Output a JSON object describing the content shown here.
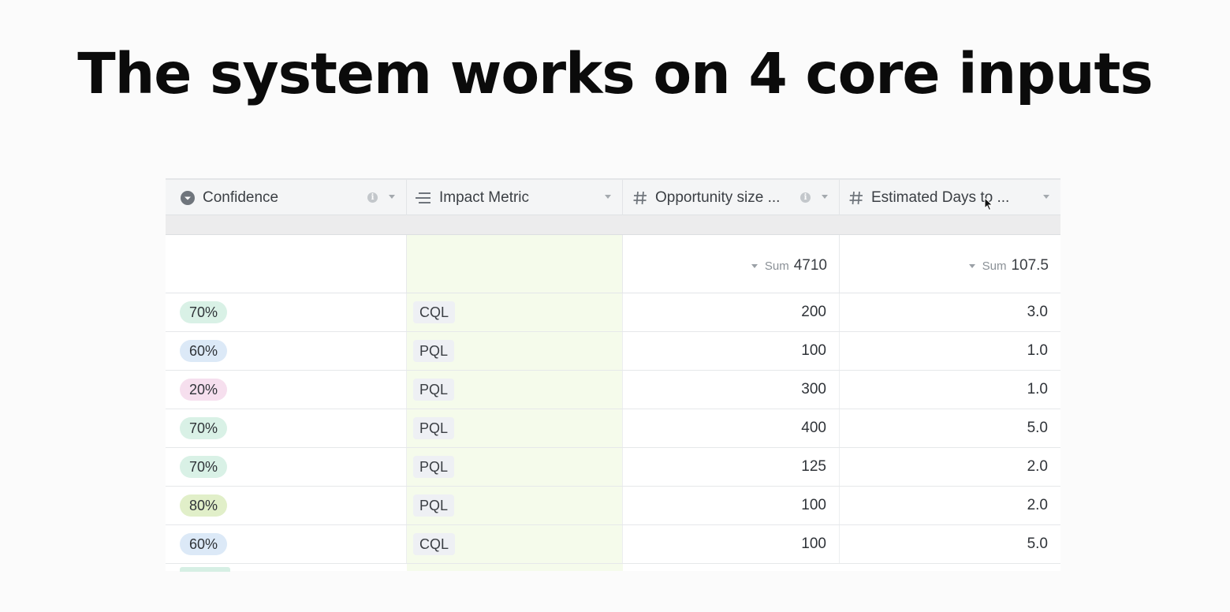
{
  "slide": {
    "title": "The system works on 4 core inputs"
  },
  "table": {
    "columns": [
      {
        "label": "Confidence",
        "icon": "single-select-icon",
        "has_info": true
      },
      {
        "label": "Impact Metric",
        "icon": "long-text-icon",
        "has_info": false
      },
      {
        "label": "Opportunity size ...",
        "icon": "number-hash-icon",
        "has_info": true
      },
      {
        "label": "Estimated Days to ...",
        "icon": "number-hash-icon",
        "has_info": false
      }
    ],
    "summary": {
      "opportunity": {
        "label": "Sum",
        "value": "4710"
      },
      "days": {
        "label": "Sum",
        "value": "107.5"
      }
    },
    "rows": [
      {
        "confidence": "70%",
        "impact": "CQL",
        "opportunity": "200",
        "days": "3.0"
      },
      {
        "confidence": "60%",
        "impact": "PQL",
        "opportunity": "100",
        "days": "1.0"
      },
      {
        "confidence": "20%",
        "impact": "PQL",
        "opportunity": "300",
        "days": "1.0"
      },
      {
        "confidence": "70%",
        "impact": "PQL",
        "opportunity": "400",
        "days": "5.0"
      },
      {
        "confidence": "70%",
        "impact": "PQL",
        "opportunity": "125",
        "days": "2.0"
      },
      {
        "confidence": "80%",
        "impact": "PQL",
        "opportunity": "100",
        "days": "2.0"
      },
      {
        "confidence": "60%",
        "impact": "CQL",
        "opportunity": "100",
        "days": "5.0"
      }
    ]
  },
  "colors": {
    "pill_70": "#d9f1e6",
    "pill_60": "#dce9f7",
    "pill_20": "#f6dfee",
    "pill_80": "#e1efc9",
    "impact_column_bg": "#f5fbeb"
  }
}
